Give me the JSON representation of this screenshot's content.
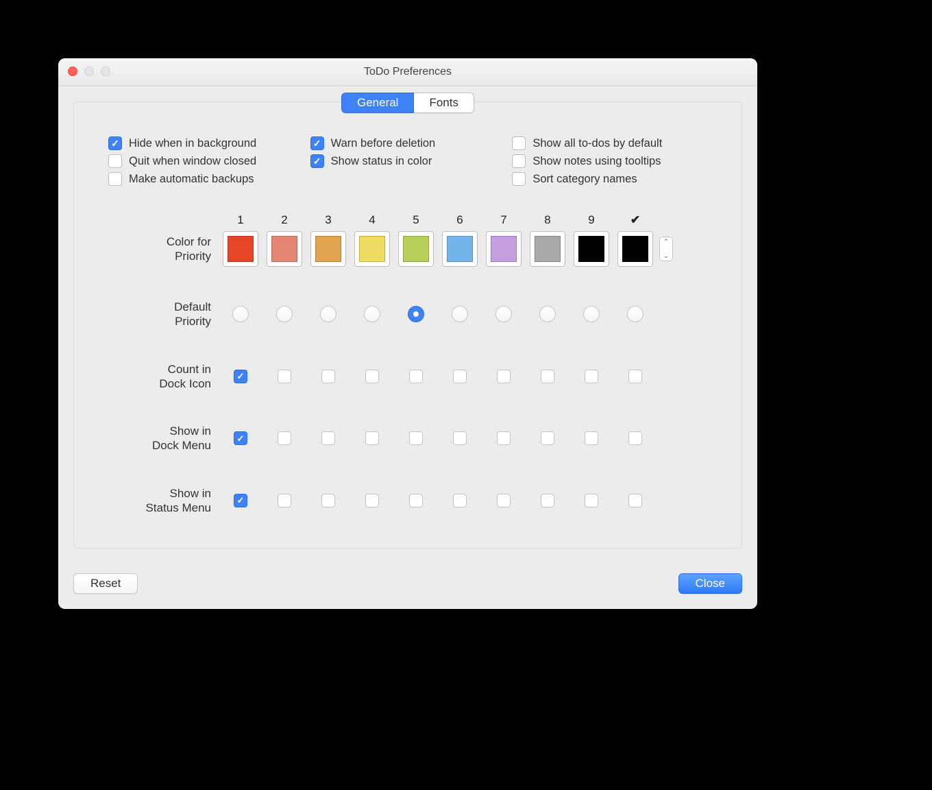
{
  "window": {
    "title": "ToDo Preferences"
  },
  "tabs": {
    "general": "General",
    "fonts": "Fonts",
    "active": "general"
  },
  "options": {
    "col1": [
      {
        "label": "Hide when in background",
        "checked": true
      },
      {
        "label": "Quit when window closed",
        "checked": false
      },
      {
        "label": "Make automatic backups",
        "checked": false
      }
    ],
    "col2": [
      {
        "label": "Warn before deletion",
        "checked": true
      },
      {
        "label": "Show status in color",
        "checked": true
      }
    ],
    "col3": [
      {
        "label": "Show all to-dos by default",
        "checked": false
      },
      {
        "label": "Show notes using tooltips",
        "checked": false
      },
      {
        "label": "Sort category names",
        "checked": false
      }
    ]
  },
  "priority": {
    "headers": [
      "1",
      "2",
      "3",
      "4",
      "5",
      "6",
      "7",
      "8",
      "9",
      "✔"
    ],
    "colors": [
      "#e64528",
      "#e38673",
      "#e2a24e",
      "#eedd60",
      "#b7ce5a",
      "#74b4ed",
      "#c49ee0",
      "#a9a9a9",
      "#000000",
      "#000000"
    ],
    "labels": {
      "color": "Color for Priority",
      "default": "Default Priority",
      "dockcount": "Count in Dock Icon",
      "dockmenu": "Show in Dock Menu",
      "statusmenu": "Show in Status Menu"
    },
    "default": [
      false,
      false,
      false,
      false,
      true,
      false,
      false,
      false,
      false,
      false
    ],
    "dockcount": [
      true,
      false,
      false,
      false,
      false,
      false,
      false,
      false,
      false,
      false
    ],
    "dockmenu": [
      true,
      false,
      false,
      false,
      false,
      false,
      false,
      false,
      false,
      false
    ],
    "statusmenu": [
      true,
      false,
      false,
      false,
      false,
      false,
      false,
      false,
      false,
      false
    ]
  },
  "footer": {
    "reset": "Reset",
    "close": "Close"
  }
}
